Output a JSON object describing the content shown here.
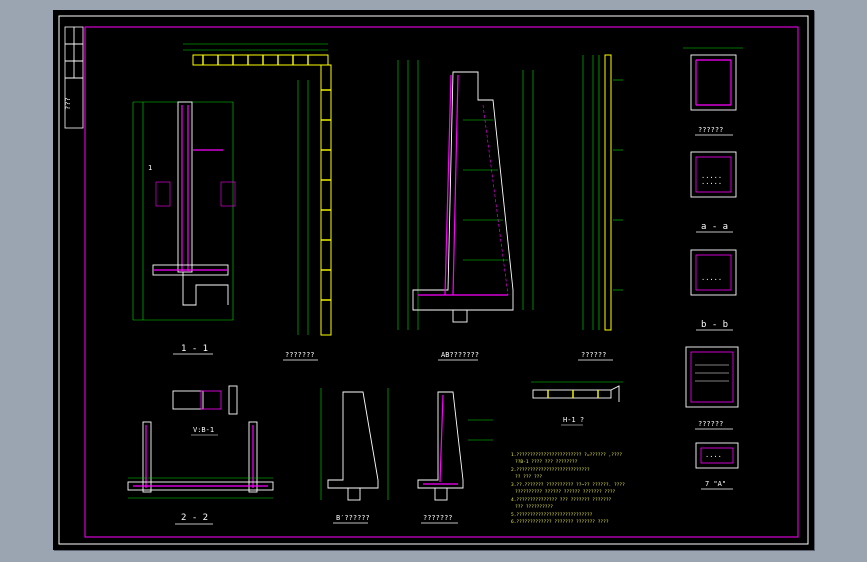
{
  "drawing": {
    "colors": {
      "background": "#000000",
      "outer_frame": "#ffffff",
      "inner_frame": "#ff00ff",
      "dimensions": "#00e000",
      "rebar": "#ff00ff",
      "concrete": "#ffffff",
      "notes": "#e8e84a",
      "highlight": "#ffff00"
    },
    "titleblock": {
      "code": "???"
    },
    "views": {
      "section_1_1": "1 - 1",
      "rebar_detail_a": "???????",
      "section_ab": "AB???????",
      "rebar_detail_b": "??????",
      "detail_c": "??????",
      "section_a_a": "a - a",
      "section_b_b": "b - b",
      "detail_d": "??????",
      "section_7": "7 \"A\"",
      "section_2_2": "2 - 2",
      "small_detail": "V:B-1",
      "detail_e": "B′??????",
      "detail_f": "???????",
      "joint_detail": "H-1 ?"
    },
    "notes": [
      "1.????????????????????????   ?=?????? ,????",
      "  ??B-1 ???? ??? ????????",
      "2.???????????????????????????",
      "  ?? ??? ???",
      "3.??.??????? ?????????? ??~?? ??????. ????",
      "  ?????????? ?????? ??????  ???????  ????",
      "4.??????????????? ??? ??????? ???????",
      "  ??? ??????????",
      "5.????????????????????????????",
      "6.????????????? ??????? ???????      ????"
    ]
  }
}
